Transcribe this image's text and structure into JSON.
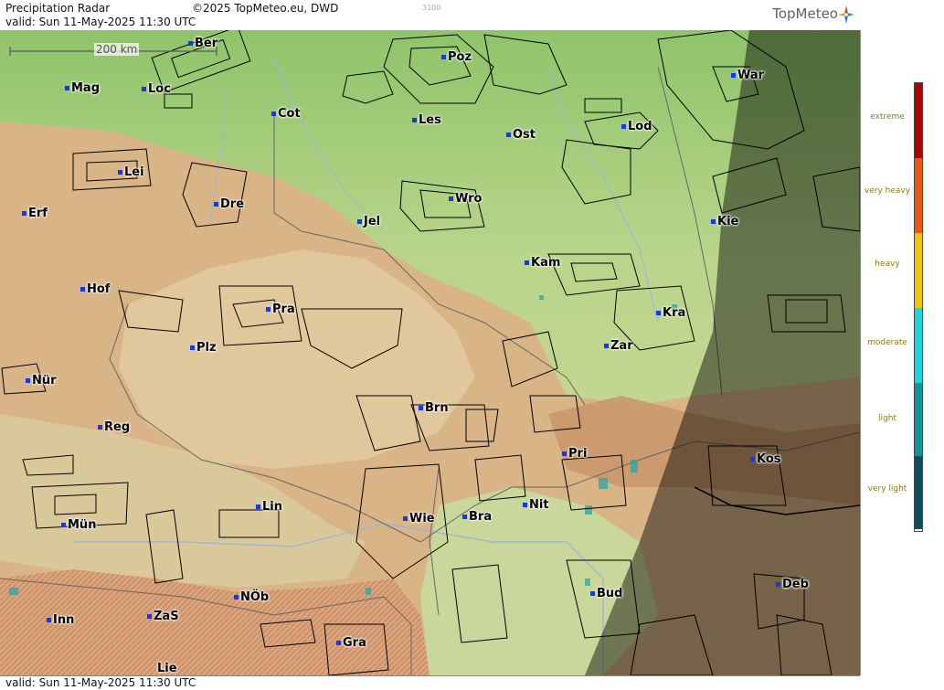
{
  "header": {
    "title": "Precipitation Radar",
    "copyright": "©2025 TopMeteo.eu, DWD",
    "altitude_mark": "3100",
    "valid": "valid:  Sun  11-May-2025 11:30 UTC",
    "logo": "TopMeteo"
  },
  "footer": {
    "valid": "valid:  Sun  11-May-2025 11:30 UTC"
  },
  "scale": {
    "label": "200 km"
  },
  "legend": {
    "items": [
      {
        "label": "extreme",
        "color": "#b00000"
      },
      {
        "label": "very heavy",
        "color": "#e85a10"
      },
      {
        "label": "heavy",
        "color": "#f3c400"
      },
      {
        "label": "moderate",
        "color": "#19d7de"
      },
      {
        "label": "light",
        "color": "#10969c"
      },
      {
        "label": "very light",
        "color": "#0d4f5e"
      }
    ]
  },
  "cities": [
    {
      "name": "Ber"
    },
    {
      "name": "Poz"
    },
    {
      "name": "War"
    },
    {
      "name": "Mag"
    },
    {
      "name": "Loc"
    },
    {
      "name": "Cot"
    },
    {
      "name": "Les"
    },
    {
      "name": "Ost"
    },
    {
      "name": "Lod"
    },
    {
      "name": "Lei"
    },
    {
      "name": "Wro"
    },
    {
      "name": "Dre"
    },
    {
      "name": "Erf"
    },
    {
      "name": "Jel"
    },
    {
      "name": "Kie"
    },
    {
      "name": "Kam"
    },
    {
      "name": "Hof"
    },
    {
      "name": "Pra"
    },
    {
      "name": "Kra"
    },
    {
      "name": "Plz"
    },
    {
      "name": "Zar"
    },
    {
      "name": "Nür"
    },
    {
      "name": "Brn"
    },
    {
      "name": "Reg"
    },
    {
      "name": "Pri"
    },
    {
      "name": "Kos"
    },
    {
      "name": "Lin"
    },
    {
      "name": "Nit"
    },
    {
      "name": "Mün"
    },
    {
      "name": "Wie"
    },
    {
      "name": "Bra"
    },
    {
      "name": "Bud"
    },
    {
      "name": "Deb"
    },
    {
      "name": "NÖb"
    },
    {
      "name": "Inn"
    },
    {
      "name": "ZaS"
    },
    {
      "name": "Gra"
    },
    {
      "name": "Lie"
    }
  ]
}
